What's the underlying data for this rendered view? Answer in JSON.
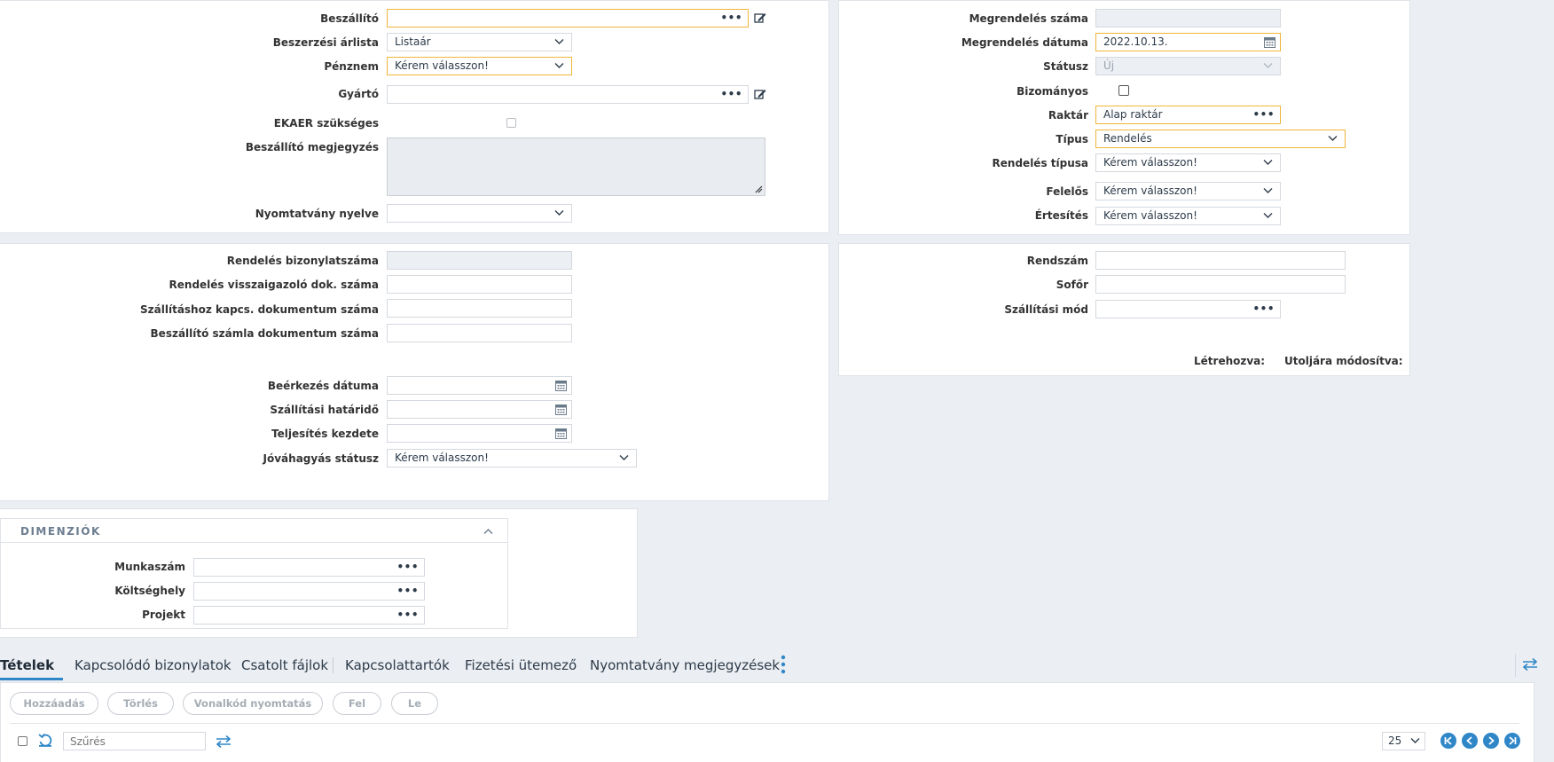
{
  "supplier_panel": {
    "supplier_label": "Beszállító",
    "supplier_value": "",
    "price_list_label": "Beszerzési árlista",
    "price_list_value": "Listaár",
    "currency_label": "Pénznem",
    "currency_value": "Kérem válasszon!",
    "manufacturer_label": "Gyártó",
    "manufacturer_value": "",
    "ekaer_label": "EKAER szükséges",
    "supplier_note_label": "Beszállító megjegyzés",
    "print_language_label": "Nyomtatvány nyelve",
    "print_language_value": ""
  },
  "order_panel": {
    "order_number_label": "Megrendelés száma",
    "order_number_value": "",
    "order_date_label": "Megrendelés dátuma",
    "order_date_value": "2022.10.13.",
    "status_label": "Státusz",
    "status_value": "Új",
    "consignment_label": "Bizományos",
    "warehouse_label": "Raktár",
    "warehouse_value": "Alap raktár",
    "type_label": "Típus",
    "type_value": "Rendelés",
    "order_type_label": "Rendelés típusa",
    "order_type_value": "Kérem válasszon!",
    "responsible_label": "Felelős",
    "responsible_value": "Kérem válasszon!",
    "notification_label": "Értesítés",
    "notification_value": "Kérem válasszon!"
  },
  "documents_panel": {
    "order_doc_number_label": "Rendelés bizonylatszáma",
    "order_confirm_doc_label": "Rendelés visszaigazoló dok. száma",
    "shipping_doc_label": "Szállításhoz kapcs. dokumentum száma",
    "supplier_invoice_doc_label": "Beszállító számla dokumentum száma",
    "arrival_date_label": "Beérkezés dátuma",
    "delivery_deadline_label": "Szállítási határidő",
    "fulfillment_start_label": "Teljesítés kezdete",
    "approval_status_label": "Jóváhagyás státusz",
    "approval_status_value": "Kérem válasszon!"
  },
  "transport_panel": {
    "plate_label": "Rendszám",
    "driver_label": "Sofőr",
    "shipping_mode_label": "Szállítási mód",
    "created_label": "Létrehozva:",
    "modified_label": "Utoljára módosítva:"
  },
  "dimensions": {
    "title": "DIMENZIÓK",
    "job_number_label": "Munkaszám",
    "cost_center_label": "Költséghely",
    "project_label": "Projekt"
  },
  "tabs": [
    {
      "label": "Tételek"
    },
    {
      "label": "Kapcsolódó bizonylatok"
    },
    {
      "label": "Csatolt fájlok"
    },
    {
      "label": "Kapcsolattartók"
    },
    {
      "label": "Fizetési ütemező"
    },
    {
      "label": "Nyomtatvány megjegyzések"
    }
  ],
  "toolbar": {
    "add_label": "Hozzáadás",
    "delete_label": "Törlés",
    "barcode_label": "Vonalkód nyomtatás",
    "up_label": "Fel",
    "down_label": "Le"
  },
  "grid_controls": {
    "filter_placeholder": "Szűrés",
    "page_size": "25"
  },
  "colors": {
    "accent": "#2f87c8",
    "required_border": "#f0b53a",
    "background": "#ebeef2"
  }
}
